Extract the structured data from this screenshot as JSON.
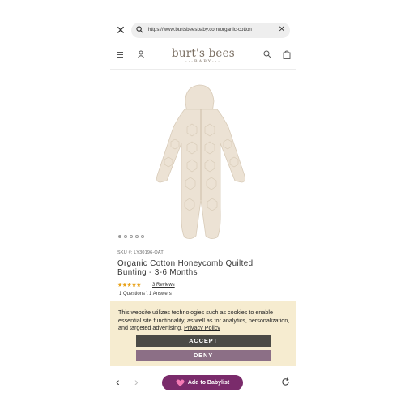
{
  "browser": {
    "url": "https://www.burtsbeesbaby.com/organic-cotton",
    "close_icon": "close-icon",
    "clear_icon": "clear-icon"
  },
  "header": {
    "logo_main": "burt's bees",
    "logo_sub": "BABY",
    "brand_color": "#7a6e61"
  },
  "product": {
    "carousel_count": 5,
    "carousel_active": 0,
    "sku": "SKU #: LY30196-OAT",
    "title": "Organic Cotton Honeycomb Quilted Bunting - 3-6 Months",
    "rating": 5,
    "stars": "★★★★★",
    "reviews": "3 Reviews",
    "qa": "1 Questions \\ 1 Answers"
  },
  "cookie": {
    "text": "This website utilizes technologies such as cookies to enable essential site functionality, as well as for analytics, personalization, and targeted advertising.",
    "link": "Privacy Policy",
    "accept": "ACCEPT",
    "deny": "DENY",
    "bg_color": "#f6ecd0"
  },
  "bottom": {
    "babylist_label": "Add to Babylist",
    "babylist_color": "#7a2b6b"
  }
}
